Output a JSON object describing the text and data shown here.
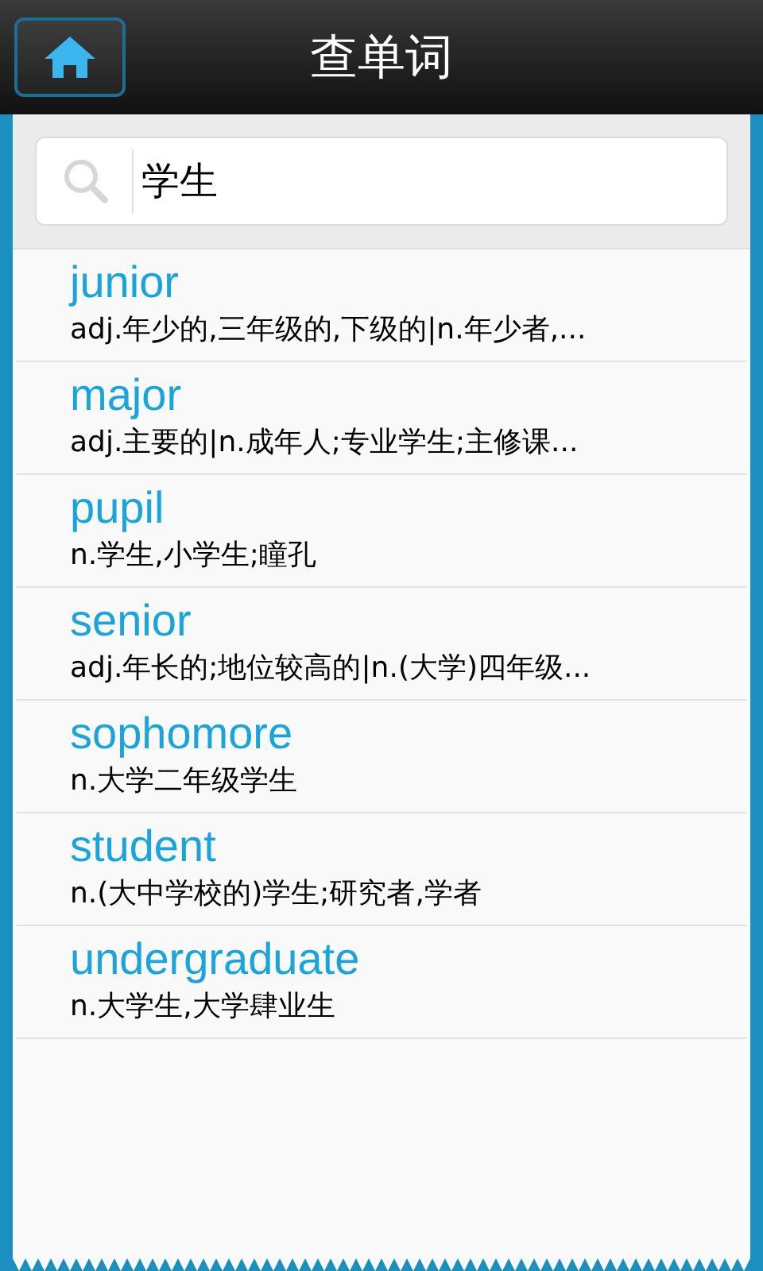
{
  "header": {
    "title": "查单词"
  },
  "search": {
    "value": "学生"
  },
  "results": [
    {
      "word": "junior",
      "definition": "adj.年少的,三年级的,下级的|n.年少者,..."
    },
    {
      "word": "major",
      "definition": "adj.主要的|n.成年人;专业学生;主修课..."
    },
    {
      "word": "pupil",
      "definition": "n.学生,小学生;瞳孔"
    },
    {
      "word": "senior",
      "definition": "adj.年长的;地位较高的|n.(大学)四年级..."
    },
    {
      "word": "sophomore",
      "definition": "n.大学二年级学生"
    },
    {
      "word": "student",
      "definition": "n.(大中学校的)学生;研究者,学者"
    },
    {
      "word": "undergraduate",
      "definition": "n.大学生,大学肆业生"
    }
  ]
}
